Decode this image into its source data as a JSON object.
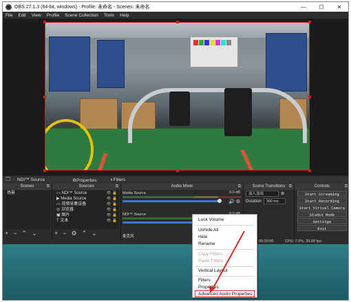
{
  "window": {
    "title": "OBS 27.1.3 (64-bit, windows) - Profile: 未命名 - Scenes: 未命名",
    "min": "—",
    "max": "☐",
    "close": "✕"
  },
  "menu": [
    "File",
    "Edit",
    "View",
    "Profile",
    "Scene Collection",
    "Tools",
    "Help"
  ],
  "source_bar": {
    "source": "NDI™ Source",
    "properties": "Properties",
    "filters": "Filters"
  },
  "docks": {
    "scenes": "Scenes",
    "sources": "Sources",
    "mixer": "Audio Mixer",
    "transitions": "Scene Transitions",
    "controls": "Controls"
  },
  "scenes_list": [
    "场景"
  ],
  "sources_list": [
    "NDI™ Source",
    "Media Source",
    "视频采集设备",
    "浏览器",
    "图片",
    "文本"
  ],
  "mixer": [
    {
      "name": "Media Source",
      "db": "0.0 dB"
    },
    {
      "name": "NDI™ Source",
      "db": "0.0 dB"
    },
    {
      "name": "麦克风",
      "db": ""
    }
  ],
  "transitions": {
    "selected": "淡入淡出",
    "duration_label": "Duration",
    "duration_value": "300 ms"
  },
  "controls": [
    "Start Streaming",
    "Start Recording",
    "Start Virtual Camera",
    "Studio Mode",
    "Settings",
    "Exit"
  ],
  "status": {
    "time": "00:00:00",
    "cpu": "CPU: 7.0%, 30.00 fps"
  },
  "context_menu": [
    {
      "label": "Lock Volume",
      "disabled": false
    },
    {
      "label": "Unhide All",
      "disabled": false
    },
    {
      "label": "Hide",
      "disabled": false
    },
    {
      "label": "Rename",
      "disabled": false
    },
    {
      "label": "Copy Filters",
      "disabled": true
    },
    {
      "label": "Paste Filters",
      "disabled": true
    },
    {
      "label": "Vertical Layout",
      "disabled": false
    },
    {
      "label": "Filters",
      "disabled": false
    },
    {
      "label": "Properties",
      "disabled": false
    },
    {
      "label": "Advanced Audio Properties",
      "disabled": false
    }
  ],
  "colors": {
    "accent_red": "#d31e1e",
    "slider_blue": "#3b7bd6",
    "desktop_teal": "#2e7e88"
  }
}
